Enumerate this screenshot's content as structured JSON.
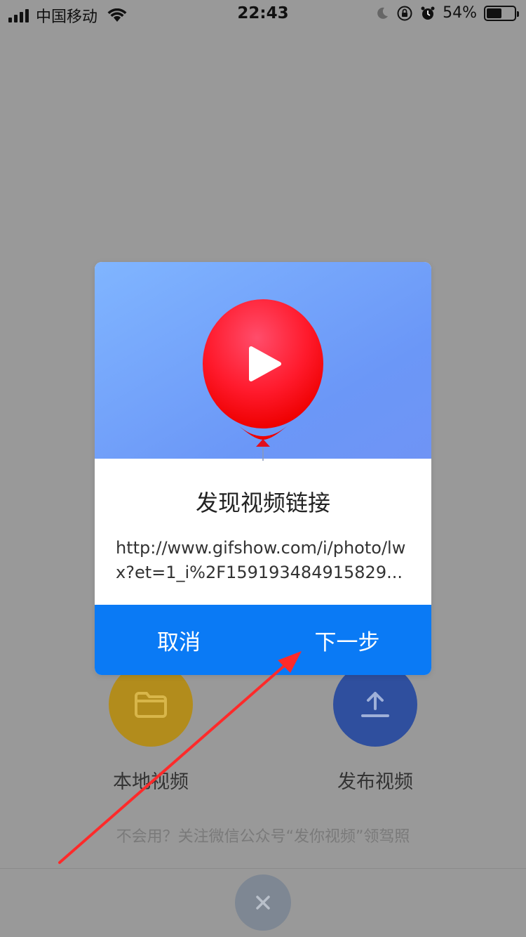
{
  "status_bar": {
    "carrier": "中国移动",
    "time": "22:43",
    "battery": "54%",
    "battery_level": 0.54
  },
  "actions": {
    "local_label": "本地视频",
    "publish_label": "发布视频"
  },
  "hint": "不会用？关注微信公众号“发你视频”领驾照",
  "dialog": {
    "title": "发现视频链接",
    "url": "http://www.gifshow.com/i/photo/lwx?et=1_i%2F159193484915829...",
    "cancel_label": "取消",
    "next_label": "下一步"
  },
  "colors": {
    "dialog_button_bg": "#0a7af5",
    "balloon": "#ff1e2d",
    "local_circle": "#b28c1c",
    "publish_circle": "#2f4f9e",
    "annotation_arrow": "#ff2a2a"
  }
}
